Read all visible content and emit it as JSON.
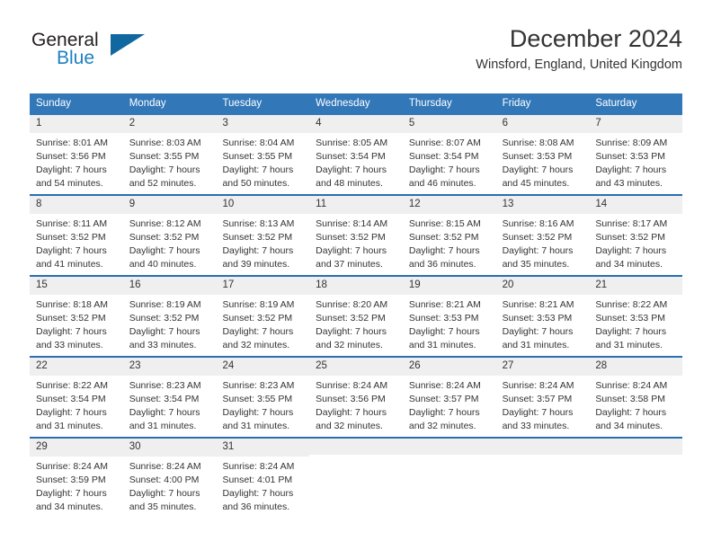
{
  "brand": {
    "name_part1": "General",
    "name_part2": "Blue",
    "triangle_color": "#11679f",
    "blue_text_color": "#1d7fc3"
  },
  "header": {
    "title": "December 2024",
    "subtitle": "Winsford, England, United Kingdom"
  },
  "calendar": {
    "header_bg_color": "#3277b8",
    "header_text_color": "#ffffff",
    "row_divider_color": "#2a6fb0",
    "day_number_bg_color": "#efefef",
    "weekdays": [
      "Sunday",
      "Monday",
      "Tuesday",
      "Wednesday",
      "Thursday",
      "Friday",
      "Saturday"
    ],
    "weeks": [
      [
        {
          "day": "1",
          "sunrise": "Sunrise: 8:01 AM",
          "sunset": "Sunset: 3:56 PM",
          "daylight_line1": "Daylight: 7 hours",
          "daylight_line2": "and 54 minutes."
        },
        {
          "day": "2",
          "sunrise": "Sunrise: 8:03 AM",
          "sunset": "Sunset: 3:55 PM",
          "daylight_line1": "Daylight: 7 hours",
          "daylight_line2": "and 52 minutes."
        },
        {
          "day": "3",
          "sunrise": "Sunrise: 8:04 AM",
          "sunset": "Sunset: 3:55 PM",
          "daylight_line1": "Daylight: 7 hours",
          "daylight_line2": "and 50 minutes."
        },
        {
          "day": "4",
          "sunrise": "Sunrise: 8:05 AM",
          "sunset": "Sunset: 3:54 PM",
          "daylight_line1": "Daylight: 7 hours",
          "daylight_line2": "and 48 minutes."
        },
        {
          "day": "5",
          "sunrise": "Sunrise: 8:07 AM",
          "sunset": "Sunset: 3:54 PM",
          "daylight_line1": "Daylight: 7 hours",
          "daylight_line2": "and 46 minutes."
        },
        {
          "day": "6",
          "sunrise": "Sunrise: 8:08 AM",
          "sunset": "Sunset: 3:53 PM",
          "daylight_line1": "Daylight: 7 hours",
          "daylight_line2": "and 45 minutes."
        },
        {
          "day": "7",
          "sunrise": "Sunrise: 8:09 AM",
          "sunset": "Sunset: 3:53 PM",
          "daylight_line1": "Daylight: 7 hours",
          "daylight_line2": "and 43 minutes."
        }
      ],
      [
        {
          "day": "8",
          "sunrise": "Sunrise: 8:11 AM",
          "sunset": "Sunset: 3:52 PM",
          "daylight_line1": "Daylight: 7 hours",
          "daylight_line2": "and 41 minutes."
        },
        {
          "day": "9",
          "sunrise": "Sunrise: 8:12 AM",
          "sunset": "Sunset: 3:52 PM",
          "daylight_line1": "Daylight: 7 hours",
          "daylight_line2": "and 40 minutes."
        },
        {
          "day": "10",
          "sunrise": "Sunrise: 8:13 AM",
          "sunset": "Sunset: 3:52 PM",
          "daylight_line1": "Daylight: 7 hours",
          "daylight_line2": "and 39 minutes."
        },
        {
          "day": "11",
          "sunrise": "Sunrise: 8:14 AM",
          "sunset": "Sunset: 3:52 PM",
          "daylight_line1": "Daylight: 7 hours",
          "daylight_line2": "and 37 minutes."
        },
        {
          "day": "12",
          "sunrise": "Sunrise: 8:15 AM",
          "sunset": "Sunset: 3:52 PM",
          "daylight_line1": "Daylight: 7 hours",
          "daylight_line2": "and 36 minutes."
        },
        {
          "day": "13",
          "sunrise": "Sunrise: 8:16 AM",
          "sunset": "Sunset: 3:52 PM",
          "daylight_line1": "Daylight: 7 hours",
          "daylight_line2": "and 35 minutes."
        },
        {
          "day": "14",
          "sunrise": "Sunrise: 8:17 AM",
          "sunset": "Sunset: 3:52 PM",
          "daylight_line1": "Daylight: 7 hours",
          "daylight_line2": "and 34 minutes."
        }
      ],
      [
        {
          "day": "15",
          "sunrise": "Sunrise: 8:18 AM",
          "sunset": "Sunset: 3:52 PM",
          "daylight_line1": "Daylight: 7 hours",
          "daylight_line2": "and 33 minutes."
        },
        {
          "day": "16",
          "sunrise": "Sunrise: 8:19 AM",
          "sunset": "Sunset: 3:52 PM",
          "daylight_line1": "Daylight: 7 hours",
          "daylight_line2": "and 33 minutes."
        },
        {
          "day": "17",
          "sunrise": "Sunrise: 8:19 AM",
          "sunset": "Sunset: 3:52 PM",
          "daylight_line1": "Daylight: 7 hours",
          "daylight_line2": "and 32 minutes."
        },
        {
          "day": "18",
          "sunrise": "Sunrise: 8:20 AM",
          "sunset": "Sunset: 3:52 PM",
          "daylight_line1": "Daylight: 7 hours",
          "daylight_line2": "and 32 minutes."
        },
        {
          "day": "19",
          "sunrise": "Sunrise: 8:21 AM",
          "sunset": "Sunset: 3:53 PM",
          "daylight_line1": "Daylight: 7 hours",
          "daylight_line2": "and 31 minutes."
        },
        {
          "day": "20",
          "sunrise": "Sunrise: 8:21 AM",
          "sunset": "Sunset: 3:53 PM",
          "daylight_line1": "Daylight: 7 hours",
          "daylight_line2": "and 31 minutes."
        },
        {
          "day": "21",
          "sunrise": "Sunrise: 8:22 AM",
          "sunset": "Sunset: 3:53 PM",
          "daylight_line1": "Daylight: 7 hours",
          "daylight_line2": "and 31 minutes."
        }
      ],
      [
        {
          "day": "22",
          "sunrise": "Sunrise: 8:22 AM",
          "sunset": "Sunset: 3:54 PM",
          "daylight_line1": "Daylight: 7 hours",
          "daylight_line2": "and 31 minutes."
        },
        {
          "day": "23",
          "sunrise": "Sunrise: 8:23 AM",
          "sunset": "Sunset: 3:54 PM",
          "daylight_line1": "Daylight: 7 hours",
          "daylight_line2": "and 31 minutes."
        },
        {
          "day": "24",
          "sunrise": "Sunrise: 8:23 AM",
          "sunset": "Sunset: 3:55 PM",
          "daylight_line1": "Daylight: 7 hours",
          "daylight_line2": "and 31 minutes."
        },
        {
          "day": "25",
          "sunrise": "Sunrise: 8:24 AM",
          "sunset": "Sunset: 3:56 PM",
          "daylight_line1": "Daylight: 7 hours",
          "daylight_line2": "and 32 minutes."
        },
        {
          "day": "26",
          "sunrise": "Sunrise: 8:24 AM",
          "sunset": "Sunset: 3:57 PM",
          "daylight_line1": "Daylight: 7 hours",
          "daylight_line2": "and 32 minutes."
        },
        {
          "day": "27",
          "sunrise": "Sunrise: 8:24 AM",
          "sunset": "Sunset: 3:57 PM",
          "daylight_line1": "Daylight: 7 hours",
          "daylight_line2": "and 33 minutes."
        },
        {
          "day": "28",
          "sunrise": "Sunrise: 8:24 AM",
          "sunset": "Sunset: 3:58 PM",
          "daylight_line1": "Daylight: 7 hours",
          "daylight_line2": "and 34 minutes."
        }
      ],
      [
        {
          "day": "29",
          "sunrise": "Sunrise: 8:24 AM",
          "sunset": "Sunset: 3:59 PM",
          "daylight_line1": "Daylight: 7 hours",
          "daylight_line2": "and 34 minutes."
        },
        {
          "day": "30",
          "sunrise": "Sunrise: 8:24 AM",
          "sunset": "Sunset: 4:00 PM",
          "daylight_line1": "Daylight: 7 hours",
          "daylight_line2": "and 35 minutes."
        },
        {
          "day": "31",
          "sunrise": "Sunrise: 8:24 AM",
          "sunset": "Sunset: 4:01 PM",
          "daylight_line1": "Daylight: 7 hours",
          "daylight_line2": "and 36 minutes."
        },
        {
          "day": "",
          "sunrise": "",
          "sunset": "",
          "daylight_line1": "",
          "daylight_line2": ""
        },
        {
          "day": "",
          "sunrise": "",
          "sunset": "",
          "daylight_line1": "",
          "daylight_line2": ""
        },
        {
          "day": "",
          "sunrise": "",
          "sunset": "",
          "daylight_line1": "",
          "daylight_line2": ""
        },
        {
          "day": "",
          "sunrise": "",
          "sunset": "",
          "daylight_line1": "",
          "daylight_line2": ""
        }
      ]
    ]
  }
}
